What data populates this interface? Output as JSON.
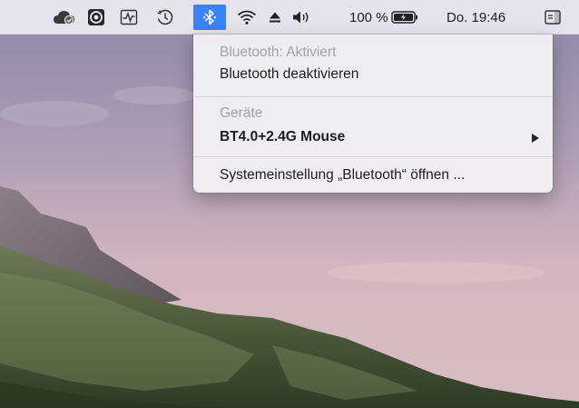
{
  "menubar": {
    "icons": [
      {
        "id": "cloud-sync",
        "name": "cloud-sync-icon"
      },
      {
        "id": "shield",
        "name": "security-app-icon"
      },
      {
        "id": "activity",
        "name": "activity-monitor-icon"
      },
      {
        "id": "time-machine",
        "name": "time-machine-icon"
      },
      {
        "id": "bluetooth",
        "name": "bluetooth-icon"
      },
      {
        "id": "wifi",
        "name": "wifi-icon"
      },
      {
        "id": "eject",
        "name": "eject-icon"
      },
      {
        "id": "volume",
        "name": "volume-icon"
      },
      {
        "id": "battery",
        "name": "battery-icon"
      },
      {
        "id": "notification",
        "name": "notification-center-icon"
      }
    ],
    "battery_percent": "100 %",
    "clock": "Do. 19:46",
    "accent_color": "#3b82f6"
  },
  "bluetooth_menu": {
    "status": "Bluetooth: Aktiviert",
    "toggle_label": "Bluetooth deaktivieren",
    "devices_header": "Geräte",
    "device_name": "BT4.0+2.4G Mouse",
    "open_prefs": "Systemeinstellung „Bluetooth“ öffnen ..."
  }
}
